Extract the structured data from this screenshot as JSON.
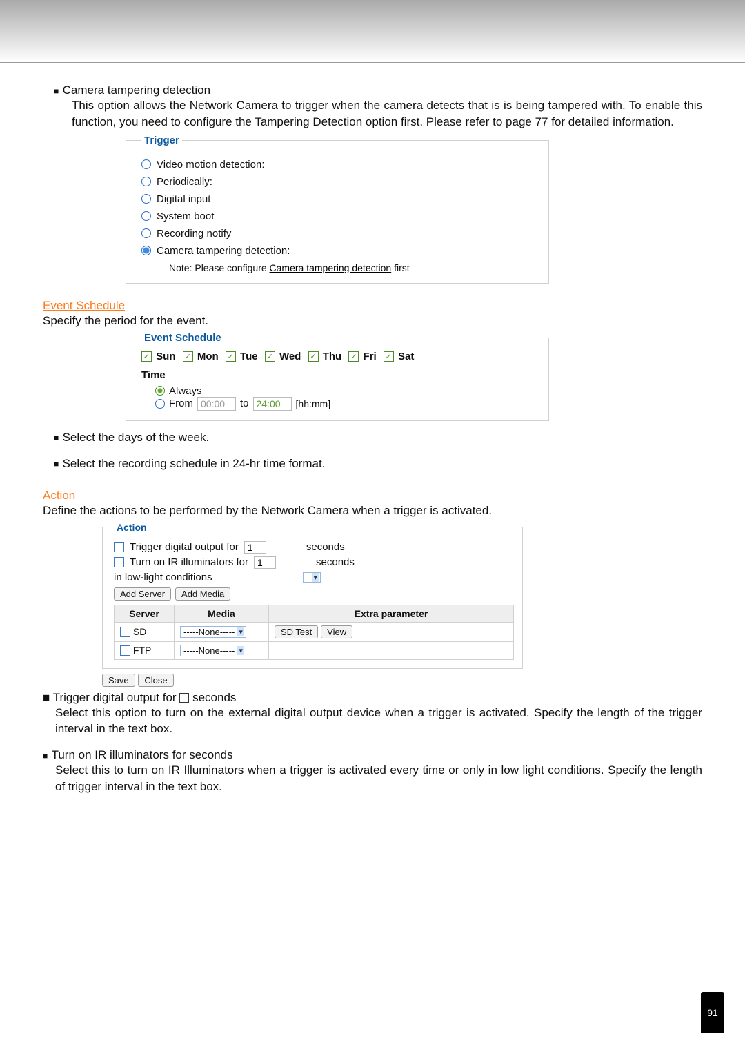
{
  "intro": {
    "title": "Camera tampering detection",
    "body": "This option allows the Network Camera to trigger when the camera detects that is is being tampered with. To enable this function, you need to configure the Tampering Detection option first. Please refer to page 77 for detailed information."
  },
  "trigger": {
    "legend": "Trigger",
    "options": {
      "video": "Video motion detection:",
      "periodically": "Periodically:",
      "digital_input": "Digital input",
      "system_boot": "System boot",
      "recording_notify": "Recording notify",
      "tampering": "Camera tampering detection:"
    },
    "note_prefix": "Note: Please configure ",
    "note_link": "Camera tampering detection",
    "note_suffix": " first"
  },
  "schedule": {
    "heading_link": "Event Schedule",
    "intro": "Specify the period for the event.",
    "legend": "Event Schedule",
    "days": [
      "Sun",
      "Mon",
      "Tue",
      "Wed",
      "Thu",
      "Fri",
      "Sat"
    ],
    "time_label": "Time",
    "always": "Always",
    "from_label": "From",
    "from_value": "00:00",
    "to_label": "to",
    "to_value": "24:00",
    "format_hint": "[hh:mm]",
    "bullets": {
      "days": "Select the days of the week.",
      "format": "Select the recording schedule in 24-hr time format."
    }
  },
  "action_section": {
    "heading_link": "Action",
    "intro": "Define the actions to be performed by the Network Camera when a trigger is activated.",
    "legend": "Action",
    "digital_out": {
      "label_pre": "Trigger digital output for",
      "value": "1",
      "label_post": "seconds"
    },
    "ir": {
      "label_pre": "Turn on IR illuminators for",
      "value": "1",
      "label_post": "seconds",
      "lowlight": "in low-light conditions"
    },
    "buttons": {
      "add_server": "Add Server",
      "add_media": "Add Media",
      "sd_test": "SD Test",
      "view": "View",
      "save": "Save",
      "close": "Close"
    },
    "table": {
      "headers": {
        "server": "Server",
        "media": "Media",
        "extra": "Extra parameter"
      },
      "rows": {
        "sd": "SD",
        "ftp": "FTP",
        "none_option": "-----None-----"
      }
    },
    "bullets": {
      "digital": {
        "title": "Trigger digital output for",
        "title_post": "seconds",
        "body": "Select this option to turn on the external digital output device when a trigger is activated. Specify the length of the trigger interval in the text box."
      },
      "ir": {
        "title": "Turn on IR illuminators for seconds",
        "body": "Select this to turn on IR Illuminators when a trigger is activated every time or only in low light conditions. Specify the length of trigger interval in the text box."
      }
    }
  },
  "page_number": "91"
}
